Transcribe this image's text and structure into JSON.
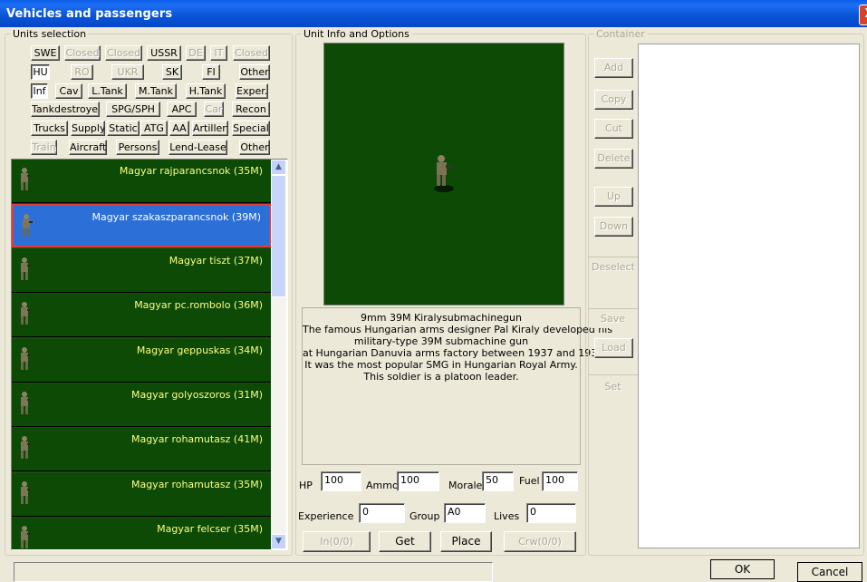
{
  "window": {
    "title": "Vehicles and passengers",
    "close_label": "X"
  },
  "units_selection": {
    "legend": "Units selection",
    "rows": [
      [
        {
          "label": "SWE",
          "state": "normal"
        },
        {
          "label": "Closed",
          "state": "disabled"
        },
        {
          "label": "Closed",
          "state": "disabled"
        },
        {
          "label": "USSR",
          "state": "normal"
        },
        {
          "label": "DE",
          "state": "disabled"
        },
        {
          "label": "IT",
          "state": "disabled"
        },
        {
          "label": "Closed",
          "state": "disabled"
        }
      ],
      [
        {
          "label": "HU",
          "state": "selected"
        },
        {
          "label": "RO",
          "state": "disabled"
        },
        {
          "label": "UKR",
          "state": "disabled"
        },
        {
          "label": "SK",
          "state": "normal"
        },
        {
          "label": "FI",
          "state": "normal"
        },
        {
          "label": "Other",
          "state": "normal"
        }
      ],
      [
        {
          "label": "Inf",
          "state": "selected"
        },
        {
          "label": "Cav",
          "state": "normal"
        },
        {
          "label": "L.Tank",
          "state": "normal"
        },
        {
          "label": "M.Tank",
          "state": "normal"
        },
        {
          "label": "H.Tank",
          "state": "normal"
        },
        {
          "label": "Exper.",
          "state": "normal"
        }
      ],
      [
        {
          "label": "Tankdestroyer",
          "state": "normal"
        },
        {
          "label": "SPG/SPH",
          "state": "normal"
        },
        {
          "label": "APC",
          "state": "normal"
        },
        {
          "label": "Car",
          "state": "disabled"
        },
        {
          "label": "Recon",
          "state": "normal"
        }
      ],
      [
        {
          "label": "Trucks",
          "state": "normal"
        },
        {
          "label": "Supply",
          "state": "normal"
        },
        {
          "label": "Static",
          "state": "normal"
        },
        {
          "label": "ATG",
          "state": "normal"
        },
        {
          "label": "AA",
          "state": "normal"
        },
        {
          "label": "Artillery",
          "state": "normal"
        },
        {
          "label": "Special",
          "state": "normal"
        }
      ],
      [
        {
          "label": "Train",
          "state": "disabled"
        },
        {
          "label": "Aircraft",
          "state": "normal"
        },
        {
          "label": "Persons",
          "state": "normal"
        },
        {
          "label": "Lend-Lease",
          "state": "normal"
        },
        {
          "label": "Other",
          "state": "normal"
        }
      ]
    ],
    "units": [
      {
        "name": "Magyar rajparancsnok (35M)",
        "selected": false
      },
      {
        "name": "Magyar szakaszparancsnok (39M)",
        "selected": true
      },
      {
        "name": "Magyar tiszt (37M)",
        "selected": false
      },
      {
        "name": "Magyar pc.rombolo (36M)",
        "selected": false
      },
      {
        "name": "Magyar geppuskas (34M)",
        "selected": false
      },
      {
        "name": "Magyar golyoszoros (31M)",
        "selected": false
      },
      {
        "name": "Magyar rohamutasz (41M)",
        "selected": false
      },
      {
        "name": "Magyar rohamutasz (35M)",
        "selected": false
      },
      {
        "name": "Magyar felcser (35M)",
        "selected": false
      }
    ]
  },
  "unit_info": {
    "legend": "Unit Info and Options",
    "description": [
      "9mm 39M Kiralysubmachinegun",
      "The famous Hungarian arms designer Pal Kiraly developed his",
      "military-type 39M submachine gun",
      "at Hungarian Danuvia arms factory between 1937 and 1939.",
      "It was the most popular SMG in Hungarian Royal Army.",
      "This soldier is a platoon leader."
    ],
    "hp_label": "HP",
    "hp_value": "100",
    "ammo_label": "Ammo",
    "ammo_value": "100",
    "morale_label": "Morale",
    "morale_value": "50",
    "fuel_label": "Fuel",
    "fuel_value": "100",
    "experience_label": "Experience",
    "experience_value": "0",
    "group_label": "Group",
    "group_value": "A0",
    "lives_label": "Lives",
    "lives_value": "0",
    "in_label": "In(0/0)",
    "get_label": "Get",
    "place_label": "Place",
    "crw_label": "Crw(0/0)"
  },
  "container": {
    "legend": "Container",
    "buttons": {
      "add": "Add",
      "copy": "Copy",
      "cut": "Cut",
      "delete": "Delete",
      "up": "Up",
      "down": "Down",
      "deselect": "Deselect",
      "save": "Save",
      "load": "Load",
      "set": "Set"
    }
  },
  "dialog": {
    "ok_label": "OK",
    "cancel_label": "Cancel"
  },
  "colors": {
    "title_bar": "#0a56d8",
    "unit_bg": "#0c4a06",
    "unit_text": "#ffff80",
    "selection": "#2c6fd6"
  }
}
